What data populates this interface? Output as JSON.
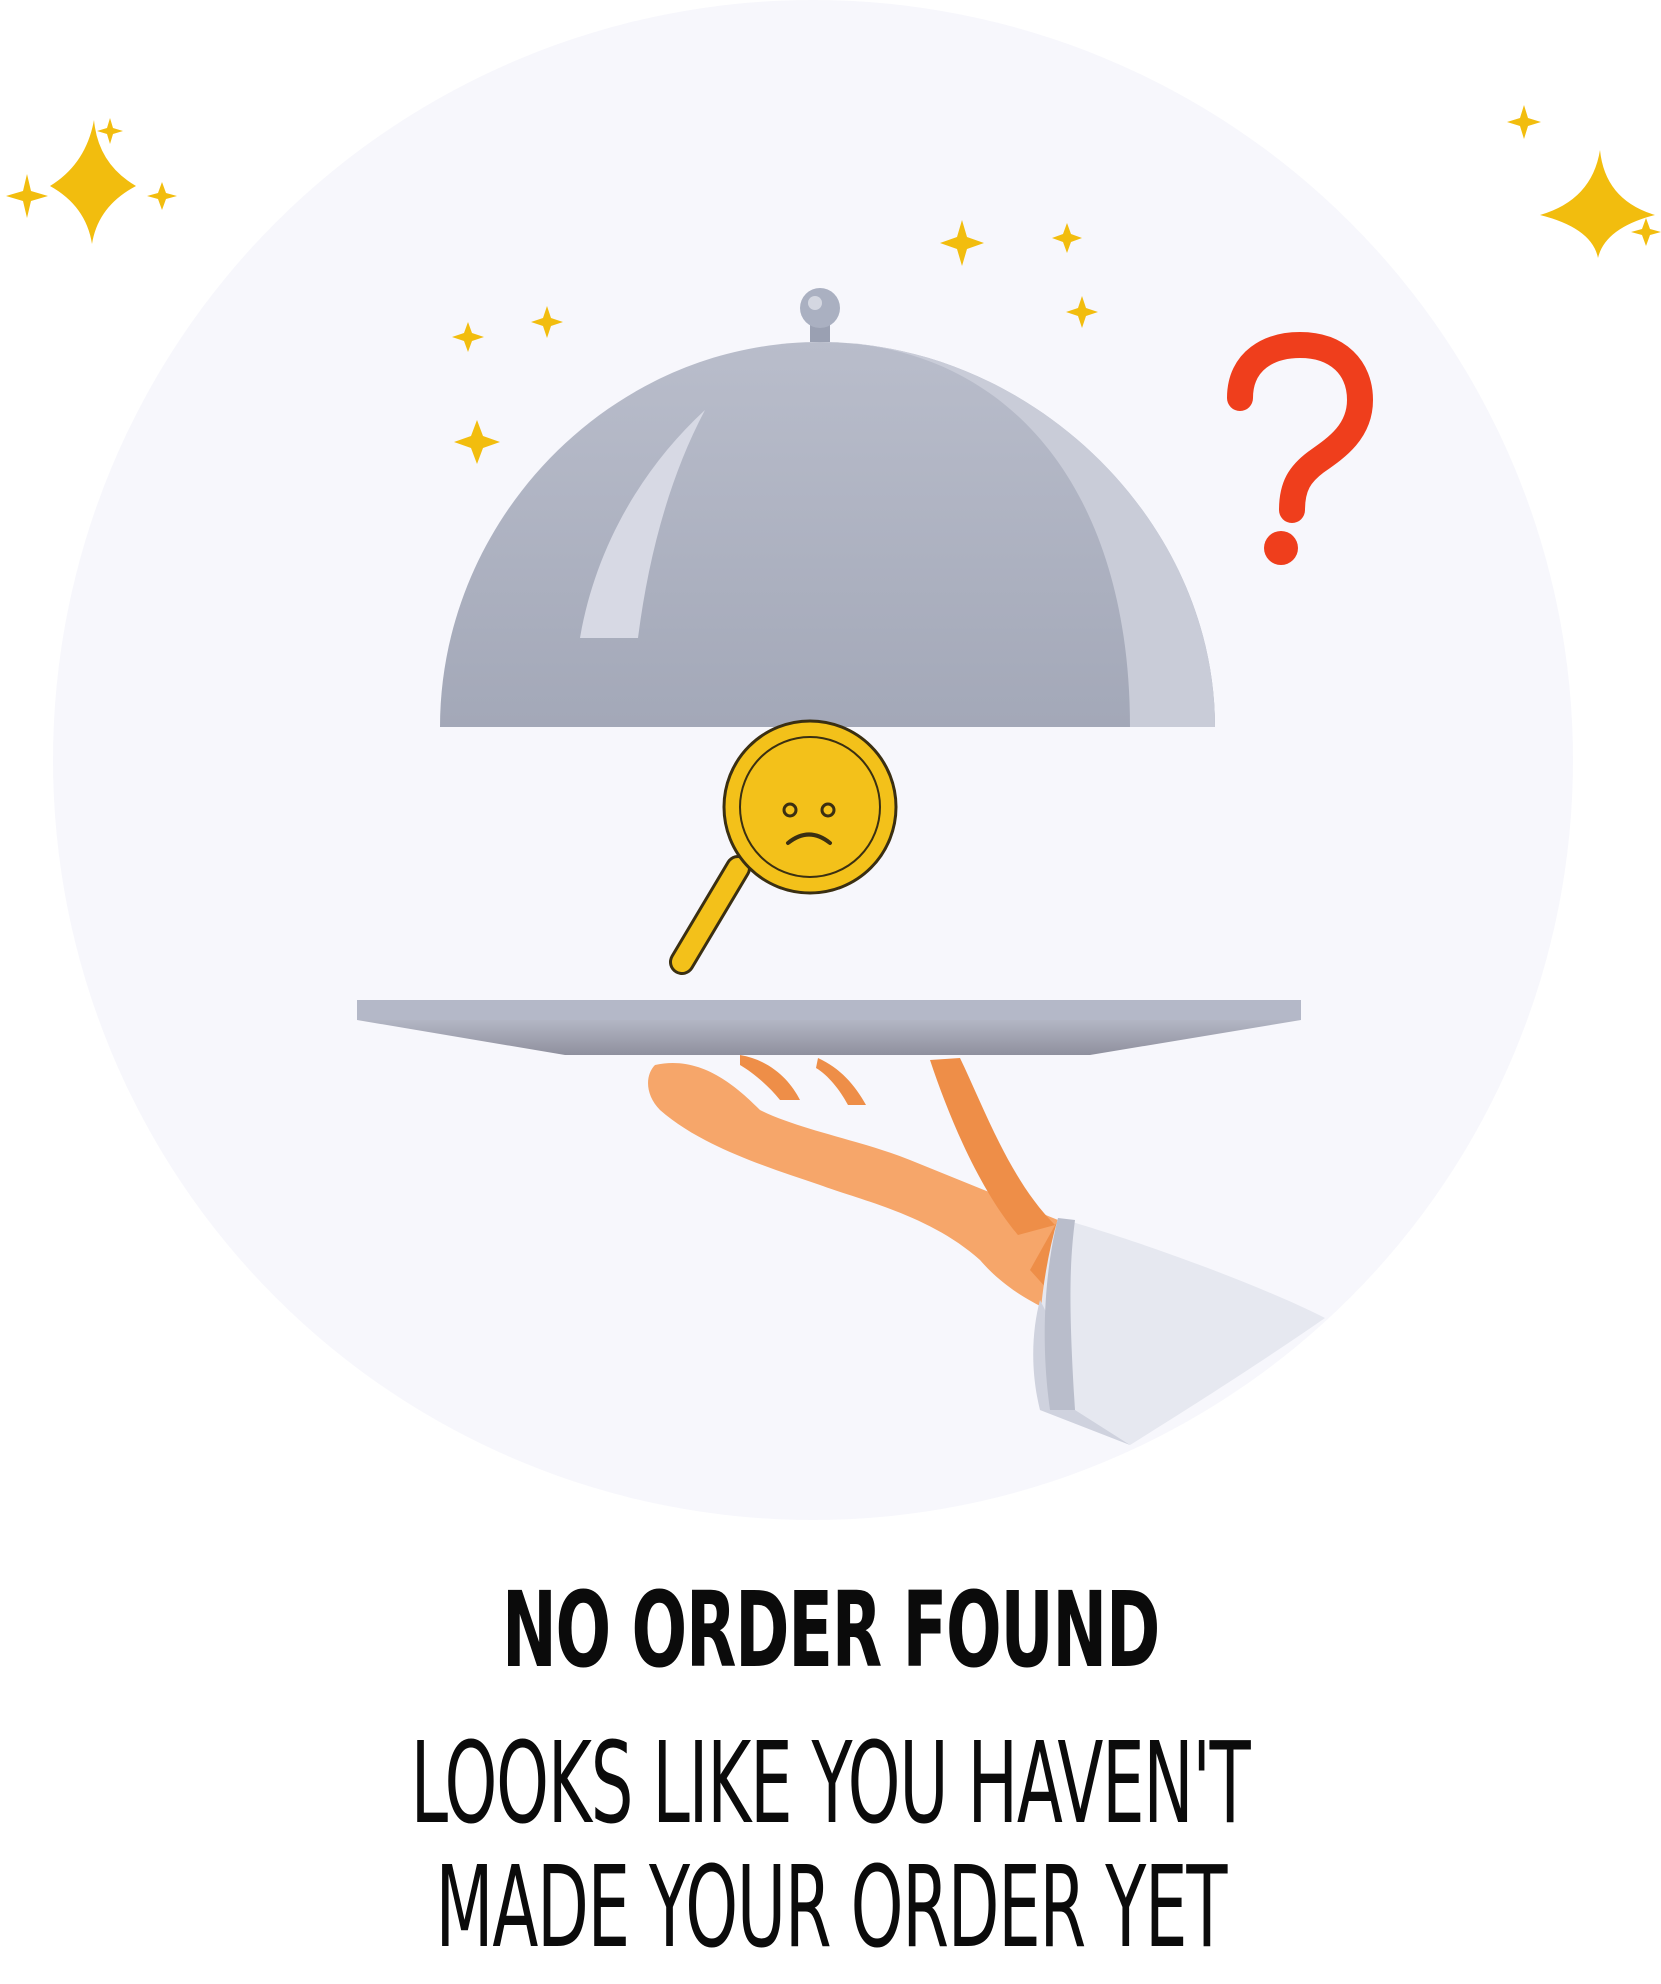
{
  "empty_state": {
    "title": "NO ORDER FOUND",
    "message_line_1": "LOOKS LIKE YOU HAVEN'T",
    "message_line_2": "MADE YOUR ORDER YET"
  },
  "illustration": {
    "question_mark": "?",
    "colors": {
      "background_circle": "#f7f7fc",
      "sparkle": "#f2bd0e",
      "question_mark": "#ef3e1c",
      "cloche": "#a8adbd",
      "magnifier": "#f3c11a",
      "hand": "#f6a66a",
      "sleeve": "#e6e8f0",
      "text": "#0b0b0b"
    }
  }
}
